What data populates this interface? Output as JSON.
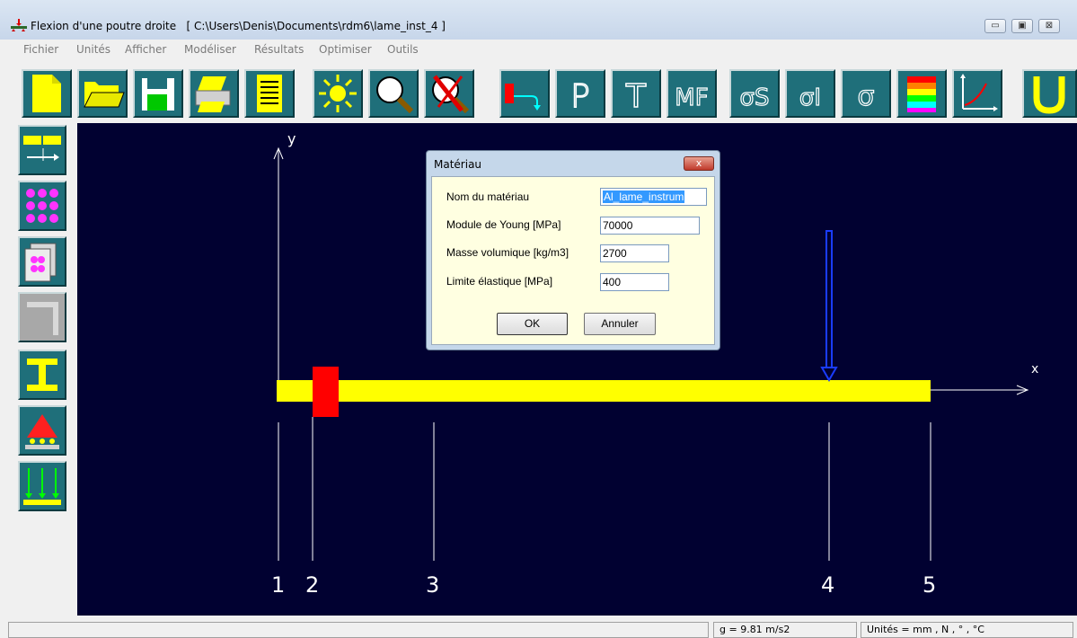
{
  "window": {
    "title": "Flexion d'une poutre droite   [ C:\\Users\\Denis\\Documents\\rdm6\\lame_inst_4 ]",
    "minimize_glyph": "▭",
    "maximize_glyph": "▣",
    "close_glyph": "⊠"
  },
  "menu": [
    "Fichier",
    "Unités",
    "Afficher",
    "Modéliser",
    "Résultats",
    "Optimiser",
    "Outils"
  ],
  "toolbar": {
    "buttons": [
      "new-file-icon",
      "open-folder-icon",
      "save-disk-icon",
      "print-icon",
      "notes-icon",
      "light-icon",
      "zoom-icon",
      "cancel-zoom-icon",
      "load-arrow-icon",
      "p-icon",
      "t-icon",
      "mf-icon",
      "sigma-s-icon",
      "sigma-i-icon",
      "sigma-icon",
      "color-scale-icon",
      "curve-icon",
      "u-icon"
    ],
    "labels": {
      "p": "P",
      "t": "T",
      "mf": "MF",
      "sigma_s": "σS",
      "sigma_i": "σI",
      "sigma": "σ",
      "u": "U"
    }
  },
  "sidebar": [
    "geometry-icon",
    "nodes-icon",
    "section-icon",
    "disabled-icon",
    "i-beam-icon",
    "support-icon",
    "distributed-load-icon"
  ],
  "canvas": {
    "axis_y": "y",
    "axis_x": "x",
    "nodes": [
      "1",
      "2",
      "3",
      "4",
      "5"
    ],
    "colors": {
      "background": "#010131",
      "beam": "#ffff00",
      "support": "#ff0000",
      "load": "#1a3cff"
    }
  },
  "dialog": {
    "title": "Matériau",
    "close_label": "x",
    "fields": [
      {
        "label": "Nom du matériau",
        "value": "Al_lame_instrum"
      },
      {
        "label": "Module de Young [MPa]",
        "value": "70000"
      },
      {
        "label": "Masse volumique [kg/m3]",
        "value": "2700"
      },
      {
        "label": "Limite élastique [MPa]",
        "value": "400"
      }
    ],
    "ok_label": "OK",
    "cancel_label": "Annuler"
  },
  "status": {
    "gravity": "g = 9.81 m/s2",
    "units": "Unités = mm , N , ° , °C"
  }
}
